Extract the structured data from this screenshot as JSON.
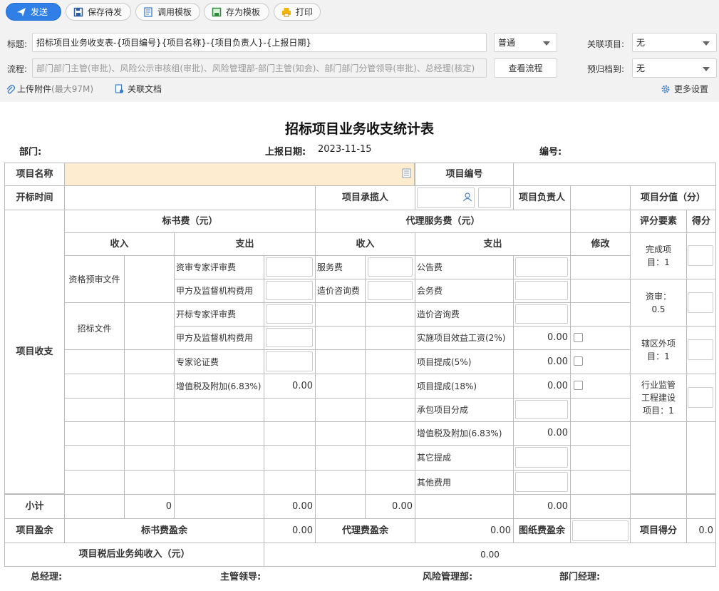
{
  "toolbar": {
    "send": "发送",
    "save_draft": "保存待发",
    "use_template": "调用模板",
    "save_template": "存为模板",
    "print": "打印"
  },
  "header_form": {
    "title_label": "标题:",
    "title_value": "招标项目业务收支表-{项目编号}{项目名称}-{项目负责人}-{上报日期}",
    "priority_value": "普通",
    "related_project_label": "关联项目:",
    "related_project_value": "无",
    "flow_label": "流程:",
    "flow_value": "部门部门主管(审批)、风险公示审核组(审批)、风险管理部-部门主管(知会)、部门部门分管领导(审批)、总经理(核定)",
    "view_flow": "查看流程",
    "archive_label": "预归档到:",
    "archive_value": "无",
    "upload_label": "上传附件",
    "upload_limit": "(最大97M)",
    "related_doc": "关联文档",
    "more_settings": "更多设置"
  },
  "form": {
    "title": "招标项目业务收支统计表",
    "dept_label": "部门:",
    "date_label": "上报日期:",
    "date_value": "2023-11-15",
    "number_label": "编号:"
  },
  "table": {
    "project_name": "项目名称",
    "project_number": "项目编号",
    "bid_time": "开标时间",
    "contractor": "项目承揽人",
    "leader": "项目负责人",
    "score_value": "项目分值（分）",
    "income_expense": "项目收支",
    "bid_doc_fee": "标书费（元）",
    "agency_fee": "代理服务费（元）",
    "eval_factor": "评分要素",
    "score": "得分",
    "income": "收入",
    "expense": "支出",
    "modify": "修改",
    "qual_doc": "资格预审文件",
    "tender_doc": "招标文件",
    "bid_rows": [
      "资审专家评审费",
      "甲方及监督机构费用",
      "开标专家评审费",
      "甲方及监督机构费用",
      "专家论证费",
      "增值税及附加(6.83%)"
    ],
    "bid_vat_value": "0.00",
    "agency_income_rows": [
      "服务费",
      "造价咨询费"
    ],
    "agency_expense_rows": [
      "公告费",
      "会务费",
      "造价咨询费",
      "实施项目效益工资(2%)",
      "项目提成(5%)",
      "项目提成(18%)",
      "承包项目分成",
      "增值税及附加(6.83%)",
      "其它提成",
      "其他费用"
    ],
    "agency_expense_values": [
      "0.00",
      "0.00",
      "0.00",
      "0.00"
    ],
    "factors": [
      "完成项目：1",
      "资审：0.5",
      "辖区外项目：1",
      "行业监管工程建设项目：1"
    ],
    "subtotal": "小计",
    "subtotal_values": [
      "0",
      "0.00",
      "0.00",
      "0.00"
    ],
    "surplus": "项目盈余",
    "bid_surplus": "标书费盈余",
    "bid_surplus_value": "0.00",
    "agency_surplus": "代理费盈余",
    "agency_surplus_value": "0.00",
    "drawing_surplus": "图纸费盈余",
    "project_score": "项目得分",
    "project_score_value": "0.0",
    "net_income": "项目税后业务纯收入（元）",
    "net_income_value": "0.00"
  },
  "signs": {
    "gm": "总经理:",
    "supervisor": "主管领导:",
    "risk": "风险管理部:",
    "dept_manager": "部门经理:"
  },
  "colors": {
    "accent": "#2f7fe6",
    "highlight": "#fdeccf"
  }
}
